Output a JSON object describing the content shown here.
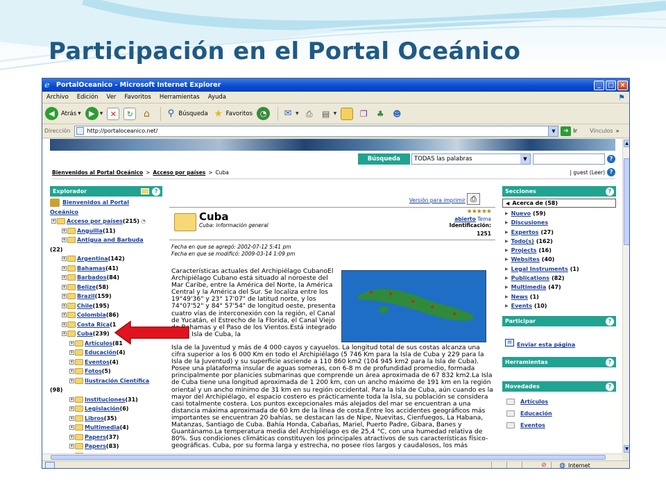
{
  "slide": {
    "title": "Participación en el Portal Oceánico"
  },
  "window": {
    "title": "PortalOceanico - Microsoft Internet Explorer",
    "min": "_",
    "max": "□",
    "close": "×"
  },
  "menu": [
    "Archivo",
    "Edición",
    "Ver",
    "Favoritos",
    "Herramientas",
    "Ayuda"
  ],
  "toolbar": {
    "back": "Atrás",
    "search": "Búsqueda",
    "favorites": "Favoritos"
  },
  "address": {
    "label": "Dirección",
    "url": "http://portaloceanico.net/",
    "go": "Ir",
    "links": "Vínculos"
  },
  "search": {
    "label": "Búsqueda",
    "option": "TODAS las palabras",
    "help": "?"
  },
  "breadcrumb": {
    "home": "Bienvenidos al Portal Oceánico",
    "sep1": ">",
    "section": "Acceso por países",
    "sep2": ">",
    "current": "Cuba",
    "user": "| guest (Leer)"
  },
  "explorer": {
    "title": "Explorador",
    "root1": "Bienvenidos al Portal",
    "root2": "Oceánico",
    "tree": [
      {
        "label": "Acceso por países",
        "count": "(215)"
      },
      {
        "label": "Anguilla",
        "count": "(11)"
      },
      {
        "label": "Antigua and Barbuda",
        "count": ""
      },
      {
        "label": "",
        "count": "(22)"
      },
      {
        "label": "Argentina",
        "count": "(142)"
      },
      {
        "label": "Bahamas",
        "count": "(41)"
      },
      {
        "label": "Barbados",
        "count": "(84)"
      },
      {
        "label": "Belize",
        "count": "(58)"
      },
      {
        "label": "Brazil",
        "count": "(159)"
      },
      {
        "label": "Chile",
        "count": "(195)"
      },
      {
        "label": "Colombia",
        "count": "(86)"
      },
      {
        "label": "Costa Rica",
        "count": "(1"
      },
      {
        "label": "Cuba",
        "count": "(239)"
      },
      {
        "label": "Artículos",
        "count": "(81"
      },
      {
        "label": "Educación",
        "count": "(4)"
      },
      {
        "label": "Eventos",
        "count": "(4)"
      },
      {
        "label": "Fotos",
        "count": "(5)"
      },
      {
        "label": "Ilustración Científica",
        "count": ""
      },
      {
        "label": "",
        "count": "(98)"
      },
      {
        "label": "Instituciones",
        "count": "(31)"
      },
      {
        "label": "Legislación",
        "count": "(6)"
      },
      {
        "label": "Libros",
        "count": "(35)"
      },
      {
        "label": "Multimedia",
        "count": "(4)"
      },
      {
        "label": "Papers",
        "count": "(37)"
      },
      {
        "label": "Papers",
        "count": "(83)"
      },
      {
        "label": "Premios",
        "count": "(5)"
      }
    ]
  },
  "article": {
    "print": "Versión para imprimir",
    "title": "Cuba",
    "subtitle": "Cuba: información general",
    "status": "abierto",
    "tema": "Tema",
    "id_label": "Identificación:",
    "id": "1251",
    "added": "Fecha en que se agregó: 2002-07-12 5:41 pm",
    "modified": "Fecha en que se modificó: 2009-03-14 1:09 pm",
    "body1": "Características actuales del Archipiélago CubanoEl Archipiélago Cubano está situado al noroeste del Mar Caribe, entre la América del Norte, la América Central y la América del Sur. Se localiza entre los 19°49'36\" y 23° 17'07\" de latitud norte, y los 74°07'52\" y 84° 57'54\" de longitud oeste, presenta cuatro vías de interconexión con la región, el Canal de Yucatán, el Estrecho de la Florida, el Canal Viejo de Bahamas y el Paso de los Vientos.Está integrado por la Isla de Cuba, la",
    "body2": "Isla de la Juventud y más de 4 000 cayos y cayuelos. La longitud total de sus costas alcanza una cifra superior a los 6 000 Km en todo el Archipiélago (5 746 Km para la Isla de Cuba y 229 para la Isla de la Juventud) y su superficie asciende a 110 860 km2 (104 945 km2 para la Isla de Cuba). Posee una plataforma insular de aguas someras, con 6-8 m de profundidad promedio, formada principalmente por planicies submarinas que comprende un área aproximada de 67 832 km2.La Isla de Cuba tiene una longitud aproximada de 1 200 km, con un ancho máximo de 191 km en la región oriental y un ancho mínimo de 31 km en su región occidental. Para la Isla de Cuba, aún cuando es la mayor del Archipiélago, el espacio costero es prácticamente toda la Isla, su población se considera casi totalmente costera. Los puntos excepcionales más alejados del mar se encuentran a una distancia máxima aproximada de 60 km de la línea de costa.Entre los accidentes geográficos más importantes se encuentran 20 bahías, se destacan las de Nipe, Nuevitas, Cienfuegos, La Habana, Matanzas, Santiago de Cuba. Bahía Honda, Cabañas, Mariel, Puerto Padre, Gibara, Banes y Guantánamo.La temperatura media del Archipiélago es de 25,4 °C, con una humedad relativa de 80%. Sus condiciones climáticas constituyen los principales atractivos de sus características físico-geográficas. Cuba, por su forma larga y estrecha, no posee ríos largos y caudalosos, los más"
  },
  "sections": {
    "title": "Secciones",
    "acerca": "Acerca de (58)",
    "items": [
      {
        "label": "Nuevo",
        "count": "(59)"
      },
      {
        "label": "Discusiones",
        "count": ""
      },
      {
        "label": "Expertos",
        "count": "(27)"
      },
      {
        "label": "Todo(s)",
        "count": "(162)"
      },
      {
        "label": "Projects",
        "count": "(16)"
      },
      {
        "label": "Websites",
        "count": "(40)"
      },
      {
        "label": "Legal Instruments",
        "count": "(1)"
      },
      {
        "label": "Publications",
        "count": "(82)"
      },
      {
        "label": "Multimedia",
        "count": "(47)"
      },
      {
        "label": "News",
        "count": "(1)"
      },
      {
        "label": "Events",
        "count": "(10)"
      }
    ]
  },
  "participar": {
    "title": "Participar",
    "link": "Enviar esta página"
  },
  "herramientas": {
    "title": "Herramientas"
  },
  "novedades": {
    "title": "Novedades",
    "items": [
      "Artículos",
      "Educación",
      "Eventos"
    ]
  },
  "status": {
    "zone": "Internet"
  },
  "colors": {
    "teal": "#21a391",
    "title_blue": "#1f5a85",
    "link": "#1a3f9a",
    "arrow": "#e0141e"
  }
}
